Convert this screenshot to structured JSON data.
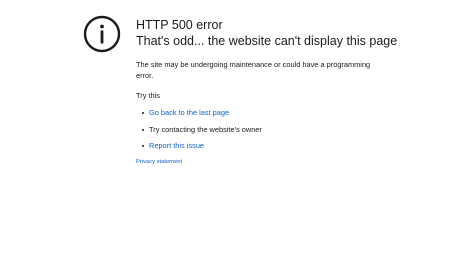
{
  "icon": "info-circle-icon",
  "colors": {
    "text": "#1b1b1b",
    "link": "#0f62c9",
    "background": "#ffffff"
  },
  "error": {
    "title_line1": "HTTP 500 error",
    "title_line2": "That's odd... the website can't display this page",
    "description": "The site may be undergoing maintenance or could have a programming error."
  },
  "try_this": {
    "heading": "Try this",
    "items": [
      {
        "label": "Go back to the last page",
        "is_link": true
      },
      {
        "label": "Try contacting the website's owner",
        "is_link": false
      },
      {
        "label": "Report this issue",
        "is_link": true
      }
    ]
  },
  "footer": {
    "privacy_label": "Privacy statement"
  }
}
